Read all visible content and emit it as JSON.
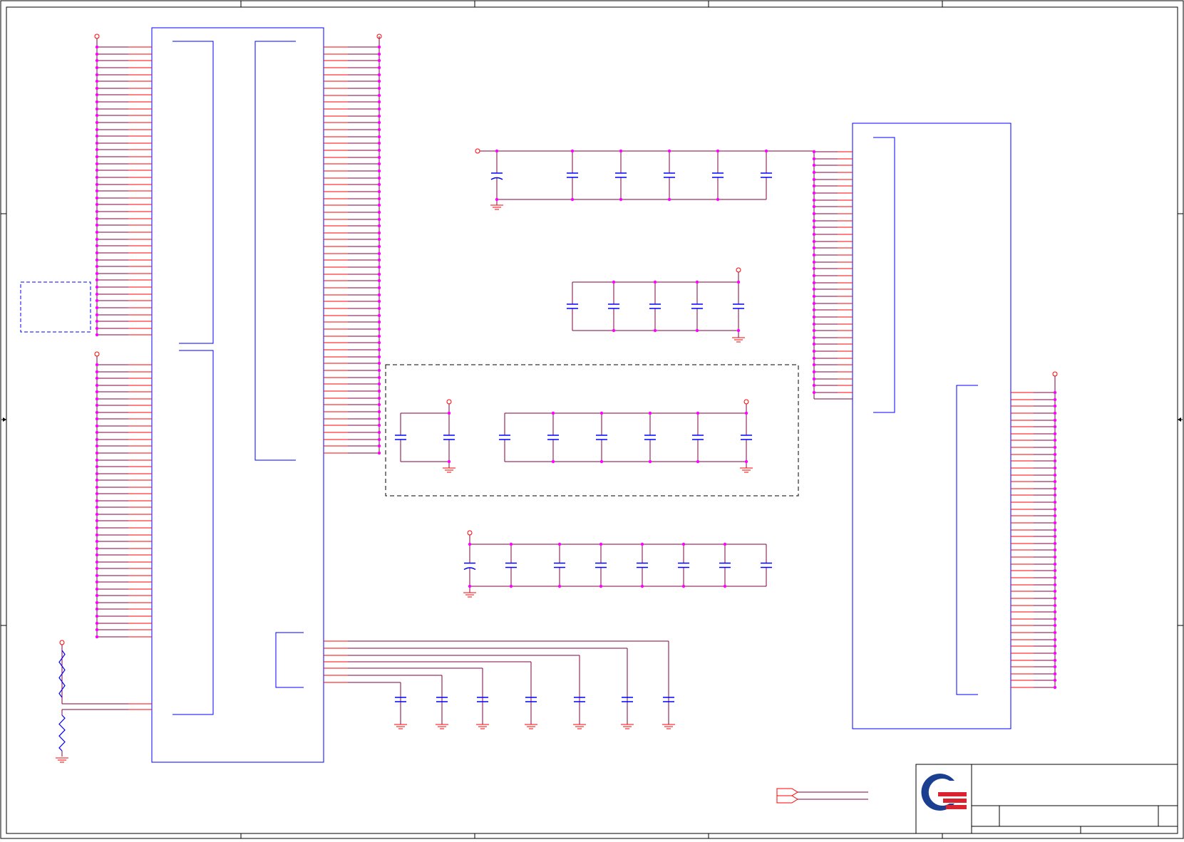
{
  "colors": {
    "frame": "#000000",
    "body": "#0000ff",
    "wire": "#800040",
    "pin": "#ff0000",
    "junction": "#ff00ff",
    "logo_blue": "#1a3f91",
    "logo_red": "#d9232e"
  },
  "icons": {
    "logo": "quanta-logo-icon",
    "ground": "ground-icon",
    "power": "power-port-icon",
    "capacitor": "capacitor-icon",
    "resistor": "resistor-icon",
    "offpage": "offpage-connector-icon"
  },
  "sheet": {
    "title_block": {
      "logo": "quanta-logo"
    }
  }
}
